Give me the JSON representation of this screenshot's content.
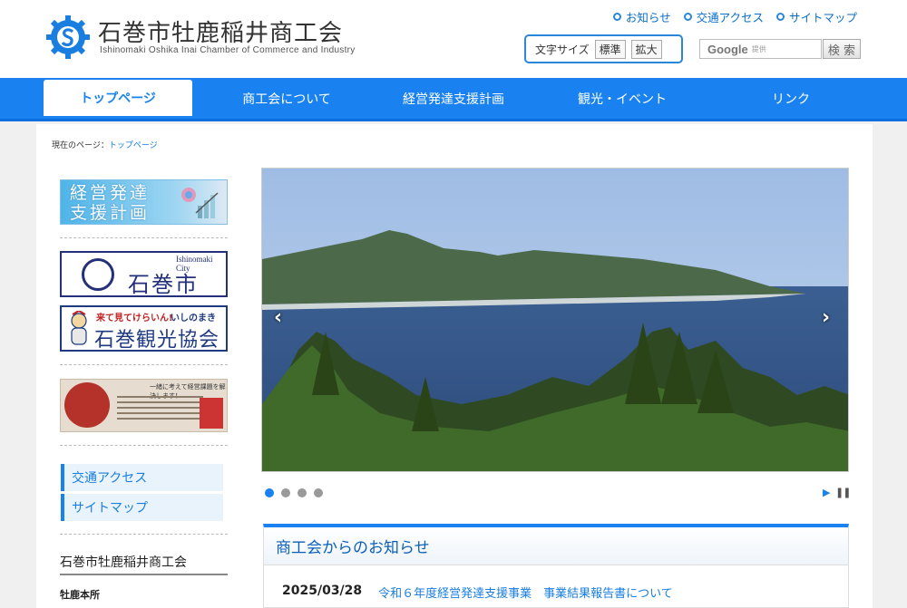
{
  "header": {
    "title": "石巻市牡鹿稲井商工会",
    "subtitle": "Ishinomaki Oshika Inai Chamber of Commerce and Industry",
    "util_links": [
      "お知らせ",
      "交通アクセス",
      "サイトマップ"
    ],
    "font_size_label": "文字サイズ",
    "font_size_normal": "標準",
    "font_size_large": "拡大",
    "search_google": "Google",
    "search_provided": "提供",
    "search_button": "検 索"
  },
  "nav": {
    "items": [
      "トップページ",
      "商工会について",
      "経営発達支援計画",
      "観光・イベント",
      "リンク"
    ],
    "active_index": 0
  },
  "breadcrumb": {
    "prefix": "現在のページ：",
    "current": "トップページ"
  },
  "sidebar": {
    "plan_banner": "経営発達\n支援計画",
    "city_banner_en": "Ishinomaki City",
    "city_banner_jp": "石巻市",
    "kanko_top": "来て見てけらいん!",
    "kanko_top2": "いしのまき",
    "kanko_main": "石巻観光協会",
    "pate_tag": "一緒に考えて経営課題を解決します！",
    "links": [
      "交通アクセス",
      "サイトマップ"
    ],
    "office_title": "石巻市牡鹿稲井商工会",
    "office_sub": "牡鹿本所"
  },
  "slider": {
    "slide_count": 4,
    "active_slide": 0,
    "prev_icon": "‹",
    "next_icon": "›",
    "play_icon": "▶",
    "pause_icon": "❚❚"
  },
  "news": {
    "heading": "商工会からのお知らせ",
    "items": [
      {
        "date": "2025/03/28",
        "title": "令和６年度経営発達支援事業　事業結果報告書について"
      }
    ]
  },
  "colors": {
    "accent": "#1a82f0",
    "link": "#1a7ee0",
    "city_navy": "#24307a"
  }
}
